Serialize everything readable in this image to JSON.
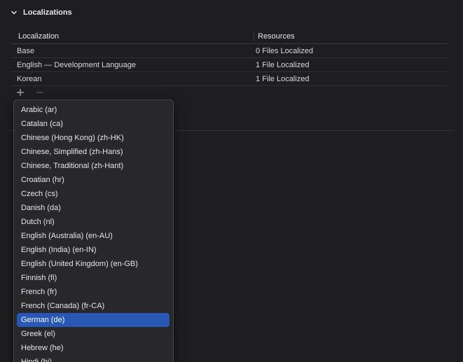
{
  "section": {
    "title": "Localizations",
    "disclosure_icon": "chevron-down-icon"
  },
  "table": {
    "columns": [
      "Localization",
      "Resources"
    ],
    "rows": [
      {
        "localization": "Base",
        "resources": "0 Files Localized"
      },
      {
        "localization": "English — Development Language",
        "resources": "1 File Localized"
      },
      {
        "localization": "Korean",
        "resources": "1 File Localized"
      }
    ]
  },
  "controls": {
    "add_icon": "plus-icon",
    "remove_icon": "minus-icon"
  },
  "language_menu": {
    "selected": "German (de)",
    "items": [
      "Arabic (ar)",
      "Catalan (ca)",
      "Chinese (Hong Kong) (zh-HK)",
      "Chinese, Simplified (zh-Hans)",
      "Chinese, Traditional (zh-Hant)",
      "Croatian (hr)",
      "Czech (cs)",
      "Danish (da)",
      "Dutch (nl)",
      "English (Australia) (en-AU)",
      "English (India) (en-IN)",
      "English (United Kingdom) (en-GB)",
      "Finnish (fi)",
      "French (fr)",
      "French (Canada) (fr-CA)",
      "German (de)",
      "Greek (el)",
      "Hebrew (he)",
      "Hindi (hi)"
    ]
  },
  "colors": {
    "background": "#1e1e20",
    "menu_background": "#28282b",
    "selection": "#2858b4"
  }
}
